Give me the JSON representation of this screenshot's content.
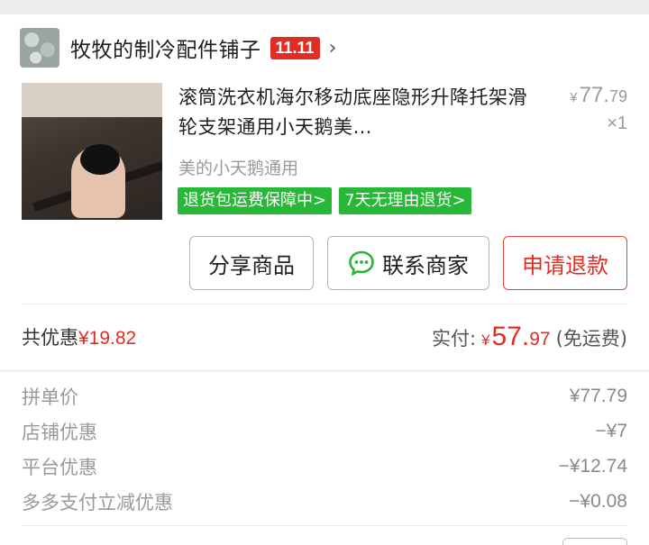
{
  "shop": {
    "name": "牧牧的制冷配件铺子",
    "badge": "11.11",
    "chevron": "›"
  },
  "product": {
    "title": "滚筒洗衣机海尔移动底座隐形升降托架滑轮支架通用小天鹅美…",
    "spec": "美的小天鹅通用",
    "price_symbol": "¥",
    "price_int": "77.",
    "price_dec": "79",
    "quantity": "×1",
    "tags": [
      "退货包运费保障中>",
      "7天无理由退货>"
    ]
  },
  "actions": {
    "share_label": "分享商品",
    "contact_label": "联系商家",
    "refund_label": "申请退款",
    "contact_icon": "chat-bubble-icon"
  },
  "summary": {
    "discount_label": "共优惠",
    "discount_value": "¥19.82",
    "paid_label": "实付:",
    "paid_symbol": "¥",
    "paid_int": "57.",
    "paid_dec": "97",
    "shipping_note": "(免运费)"
  },
  "details": [
    {
      "label": "拼单价",
      "value": "¥77.79"
    },
    {
      "label": "店铺优惠",
      "value": "−¥7"
    },
    {
      "label": "平台优惠",
      "value": "−¥12.74"
    },
    {
      "label": "多多支付立减优惠",
      "value": "−¥0.08"
    }
  ],
  "colors": {
    "accent_red": "#e02e24",
    "tag_green": "#26b836",
    "muted_gray": "#9a9a9a"
  }
}
